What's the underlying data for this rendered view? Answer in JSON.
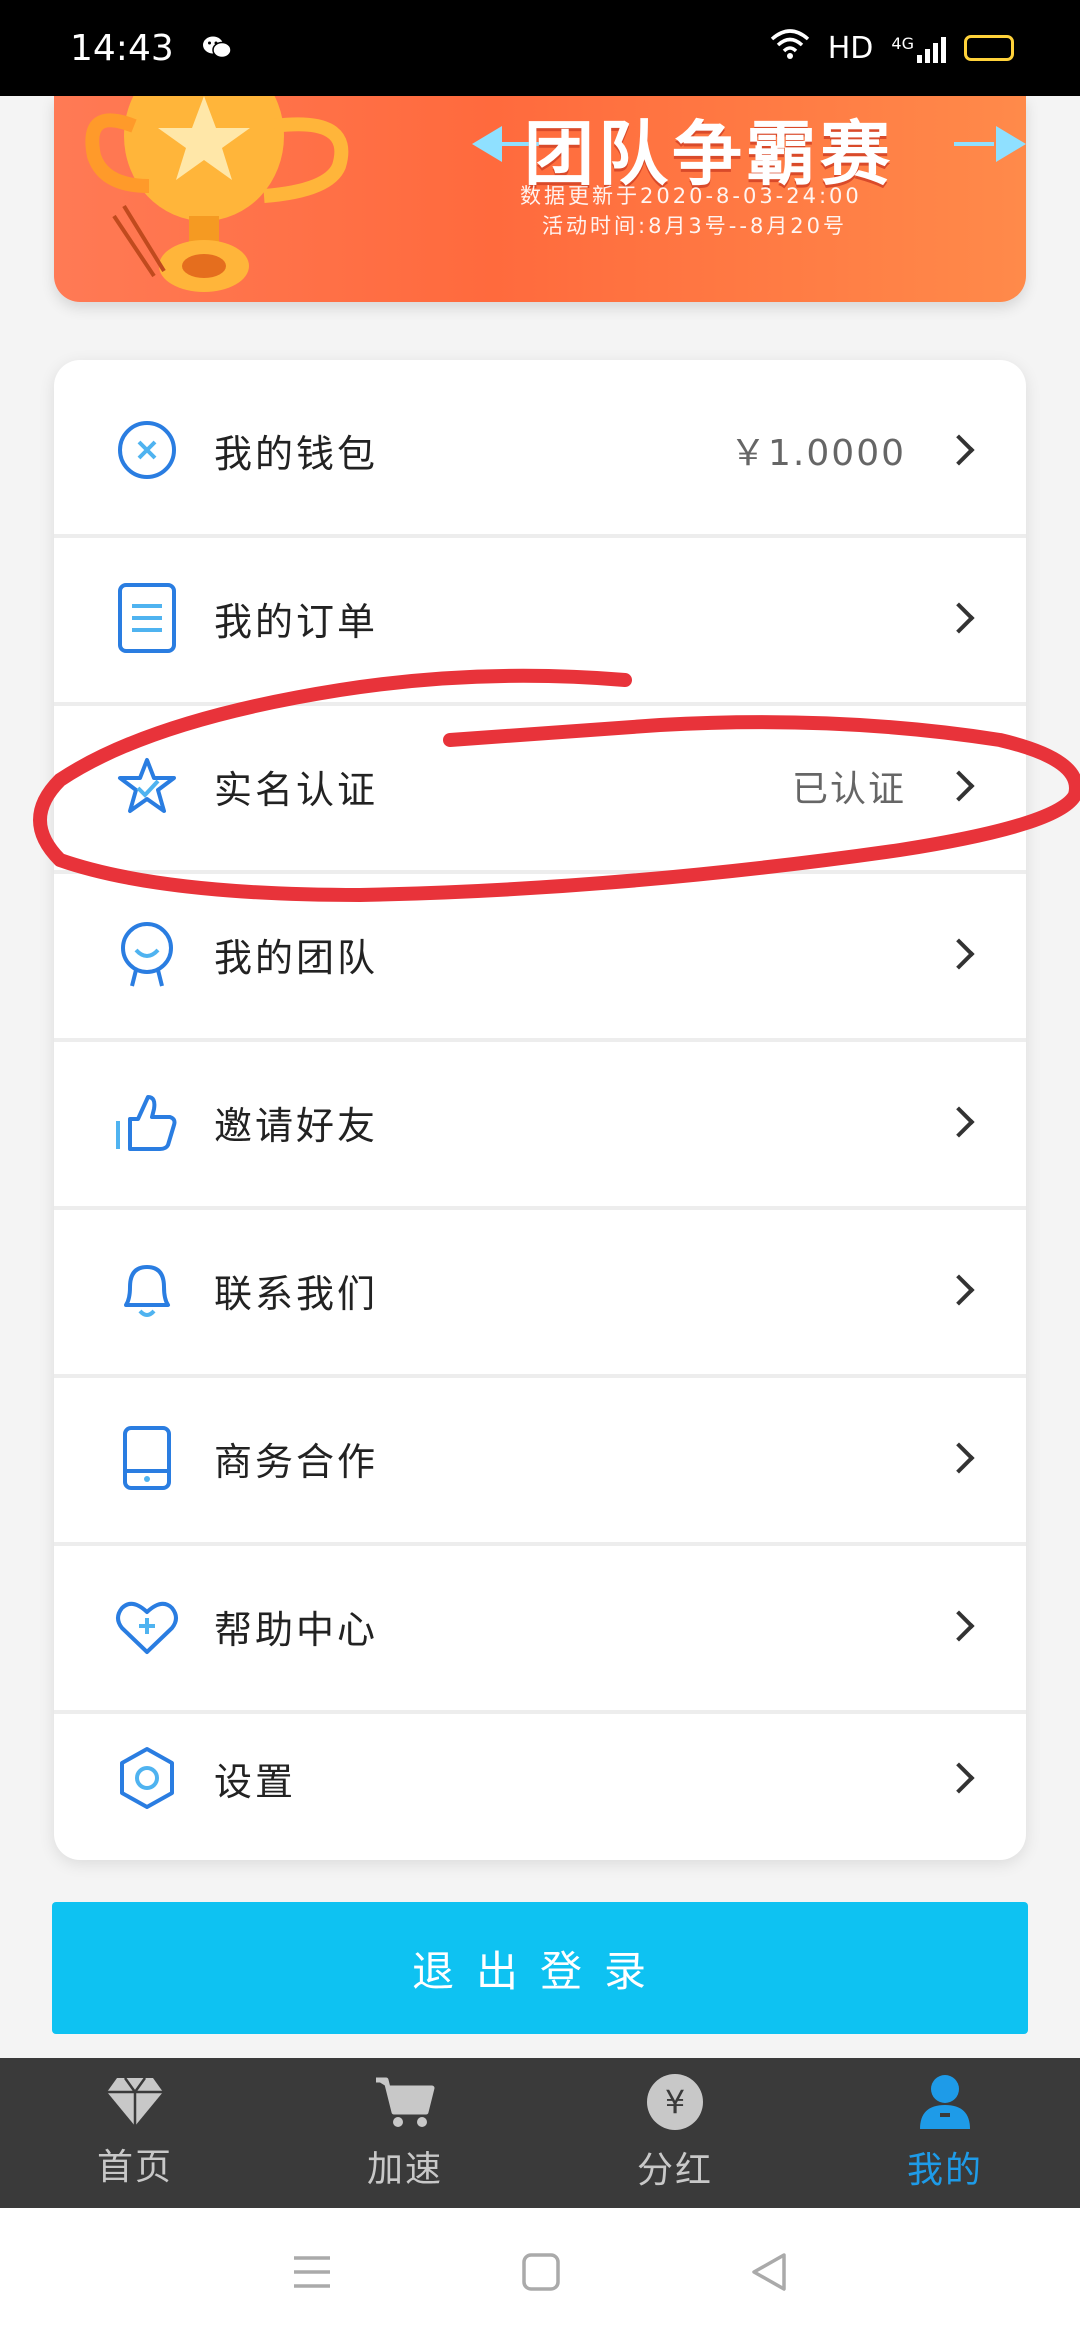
{
  "status_bar": {
    "time": "14:43",
    "network": "HD",
    "signal": "4G"
  },
  "banner": {
    "title": "团队争霸赛",
    "update_text": "数据更新于2020-8-03-24:00",
    "activity_text": "活动时间:8月3号--8月20号"
  },
  "menu": {
    "items": [
      {
        "label": "我的钱包",
        "value": "￥1.0000",
        "icon": "wallet-icon"
      },
      {
        "label": "我的订单",
        "value": "",
        "icon": "order-icon"
      },
      {
        "label": "实名认证",
        "value": "已认证",
        "icon": "verify-star-icon"
      },
      {
        "label": "我的团队",
        "value": "",
        "icon": "team-icon"
      },
      {
        "label": "邀请好友",
        "value": "",
        "icon": "thumbs-up-icon"
      },
      {
        "label": "联系我们",
        "value": "",
        "icon": "bell-icon"
      },
      {
        "label": "商务合作",
        "value": "",
        "icon": "phone-icon"
      },
      {
        "label": "帮助中心",
        "value": "",
        "icon": "heart-plus-icon"
      },
      {
        "label": "设置",
        "value": "",
        "icon": "hexagon-settings-icon"
      }
    ]
  },
  "logout": {
    "label": "退出登录"
  },
  "tabbar": {
    "tabs": [
      {
        "label": "首页",
        "icon": "diamond-icon"
      },
      {
        "label": "加速",
        "icon": "cart-icon"
      },
      {
        "label": "分红",
        "icon": "yen-coin-icon"
      },
      {
        "label": "我的",
        "icon": "user-icon",
        "active": true
      }
    ]
  },
  "colors": {
    "accent": "#0ec2f2",
    "icon_blue": "#2a7de1",
    "active_tab": "#1e9be8",
    "annotation": "#e8333a"
  }
}
